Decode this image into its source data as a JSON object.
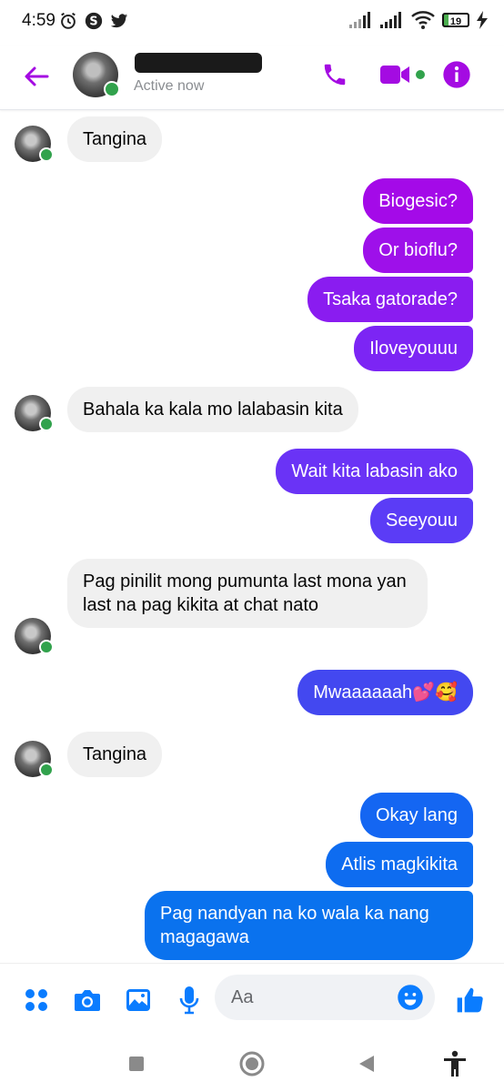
{
  "status_bar": {
    "time": "4:59",
    "battery_level": "19",
    "icons_left": [
      "alarm-icon",
      "s-app-icon",
      "twitter-icon"
    ],
    "icons_right": [
      "signal-icon",
      "signal-icon",
      "wifi-icon",
      "battery-icon",
      "charging-icon"
    ]
  },
  "header": {
    "contact_name": "",
    "status": "Active now",
    "accent_color": "#a40be2"
  },
  "messages": [
    {
      "side": "incoming",
      "text": "Tangina",
      "avatar": true
    },
    {
      "side": "outgoing",
      "text": "Biogesic?",
      "color": "#a40ae8"
    },
    {
      "side": "outgoing",
      "text": "Or bioflu?",
      "color": "#9e10ea"
    },
    {
      "side": "outgoing",
      "text": "Tsaka gatorade?",
      "color": "#8a1cf0"
    },
    {
      "side": "outgoing",
      "text": "Iloveyouuu",
      "color": "#7c25f4"
    },
    {
      "side": "incoming",
      "text": "Bahala ka kala mo lalabasin kita",
      "avatar": true
    },
    {
      "side": "outgoing",
      "text": "Wait kita labasin ako",
      "color": "#6a33f6"
    },
    {
      "side": "outgoing",
      "text": "Seeyouu",
      "color": "#5b3cf6"
    },
    {
      "side": "incoming",
      "text": "Pag pinilit mong pumunta last mona yan last na pag kikita at chat nato",
      "avatar": true
    },
    {
      "side": "outgoing",
      "text": "Mwaaaaaah💕🥰",
      "color": "#4348f0"
    },
    {
      "side": "incoming",
      "text": "Tangina",
      "avatar": true
    },
    {
      "side": "outgoing",
      "text": "Okay lang",
      "color": "#1466f2"
    },
    {
      "side": "outgoing",
      "text": "Atlis magkikita",
      "color": "#0e6cf0"
    },
    {
      "side": "outgoing",
      "text": "Pag nandyan na ko wala ka nang magagawa",
      "color": "#0a72ee"
    }
  ],
  "composer": {
    "placeholder": "Aa",
    "accent_color": "#0a7cff",
    "buttons": [
      "apps-icon",
      "camera-icon",
      "gallery-icon",
      "microphone-icon",
      "emoji-icon",
      "thumbs-up-icon"
    ]
  },
  "nav_bar": {
    "buttons": [
      "recents-icon",
      "home-icon",
      "back-icon",
      "accessibility-icon"
    ]
  }
}
